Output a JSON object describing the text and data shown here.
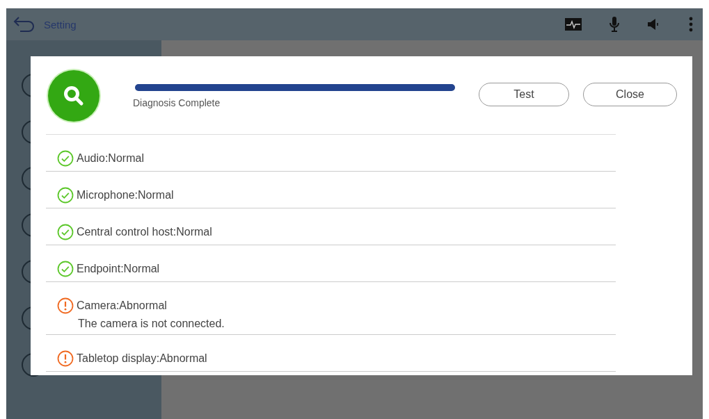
{
  "top_bar": {
    "title": "Setting"
  },
  "dialog": {
    "progress": {
      "level": 1,
      "status": "Diagnosis Complete"
    },
    "buttons": [
      "Test",
      "Close"
    ],
    "results": [
      {
        "kind": "normal",
        "text": "Audio:Normal"
      },
      {
        "kind": "normal",
        "text": "Microphone:Normal"
      },
      {
        "kind": "normal",
        "text": "Central control host:Normal"
      },
      {
        "kind": "normal",
        "text": "Endpoint:Normal"
      },
      {
        "kind": "abnormal",
        "text": "Camera:Abnormal",
        "detail": "The camera is not connected."
      },
      {
        "kind": "abnormal",
        "text": "Tabletop display:Abnormal"
      }
    ]
  }
}
